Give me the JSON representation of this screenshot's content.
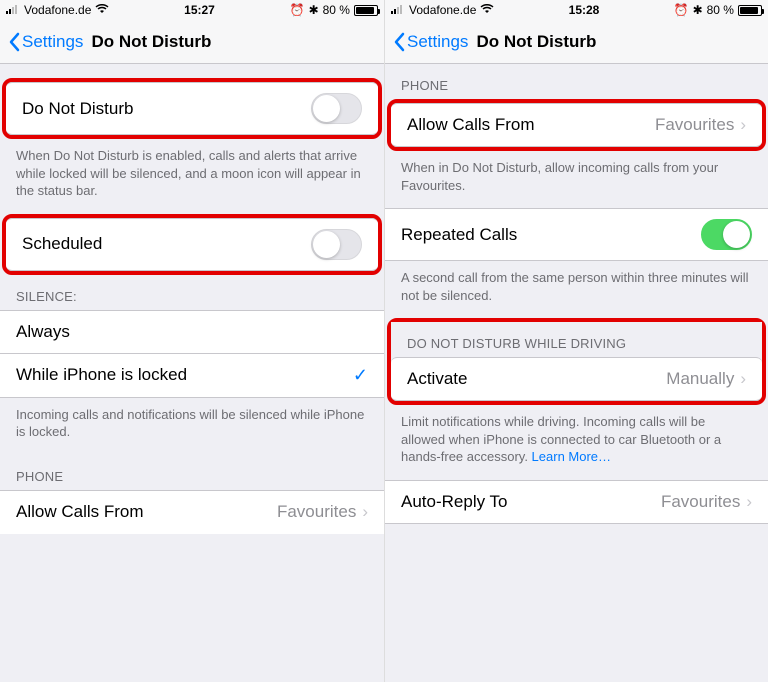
{
  "left": {
    "status": {
      "carrier": "Vodafone.de",
      "time": "15:27",
      "battery": "80 %"
    },
    "nav": {
      "back": "Settings",
      "title": "Do Not Disturb"
    },
    "dnd": {
      "label": "Do Not Disturb",
      "on": false
    },
    "dnd_footer": "When Do Not Disturb is enabled, calls and alerts that arrive while locked will be silenced, and a moon icon will appear in the status bar.",
    "scheduled": {
      "label": "Scheduled",
      "on": false
    },
    "silence_header": "SILENCE:",
    "silence": {
      "always": "Always",
      "locked": "While iPhone is locked",
      "selected": "locked"
    },
    "silence_footer": "Incoming calls and notifications will be silenced while iPhone is locked.",
    "phone_header": "PHONE",
    "allow_calls": {
      "label": "Allow Calls From",
      "value": "Favourites"
    }
  },
  "right": {
    "status": {
      "carrier": "Vodafone.de",
      "time": "15:28",
      "battery": "80 %"
    },
    "nav": {
      "back": "Settings",
      "title": "Do Not Disturb"
    },
    "phone_header": "PHONE",
    "allow_calls": {
      "label": "Allow Calls From",
      "value": "Favourites"
    },
    "allow_calls_footer": "When in Do Not Disturb, allow incoming calls from your Favourites.",
    "repeated": {
      "label": "Repeated Calls",
      "on": true
    },
    "repeated_footer": "A second call from the same person within three minutes will not be silenced.",
    "driving_header": "DO NOT DISTURB WHILE DRIVING",
    "activate": {
      "label": "Activate",
      "value": "Manually"
    },
    "driving_footer": "Limit notifications while driving. Incoming calls will be allowed when iPhone is connected to car Bluetooth or a hands-free accessory. ",
    "driving_footer_link": "Learn More…",
    "auto_reply": {
      "label": "Auto-Reply To",
      "value": "Favourites"
    }
  }
}
